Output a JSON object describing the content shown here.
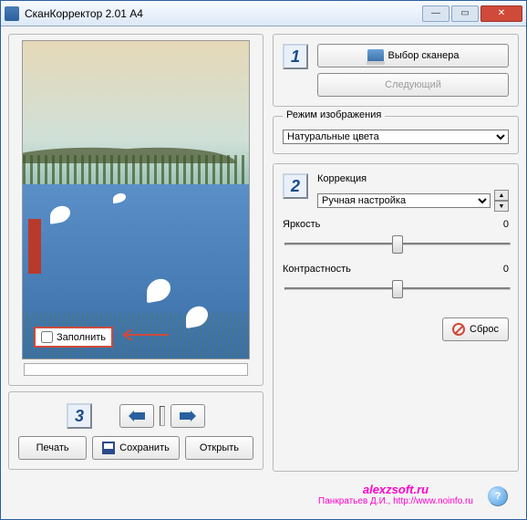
{
  "window": {
    "title": "СканКорректор 2.01 A4"
  },
  "fill": {
    "label": "Заполнить",
    "checked": false
  },
  "bottom_buttons": {
    "print": "Печать",
    "save": "Сохранить",
    "open": "Открыть"
  },
  "scanner_panel": {
    "step_num": "1",
    "select_scanner": "Выбор сканера",
    "next": "Следующий"
  },
  "image_mode": {
    "legend": "Режим изображения",
    "selected": "Натуральные цвета"
  },
  "correction": {
    "step_num": "2",
    "label": "Коррекция",
    "mode_selected": "Ручная настройка",
    "brightness_label": "Яркость",
    "brightness_value": "0",
    "contrast_label": "Контрастность",
    "contrast_value": "0",
    "reset": "Сброс"
  },
  "nav": {
    "step_num": "3"
  },
  "footer": {
    "site": "alexzsoft.ru",
    "credit": "Панкратьев Д.И., http://www.noinfo.ru"
  }
}
